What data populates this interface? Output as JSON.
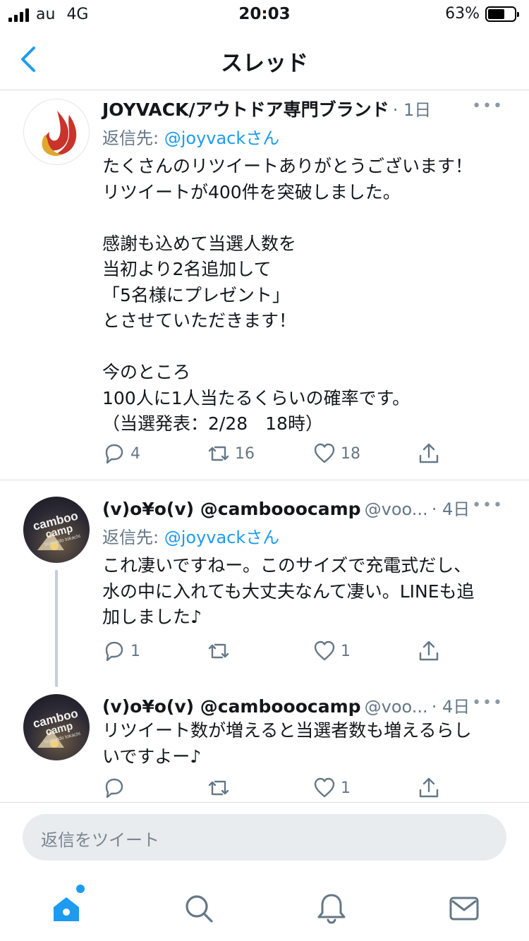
{
  "status_bar": {
    "carrier": "au",
    "network": "4G",
    "time": "20:03",
    "battery": "63%",
    "battery_level": 0.63
  },
  "nav": {
    "title": "スレッド"
  },
  "tweets": [
    {
      "name": "JOYVACK/アウトドア専門ブランド",
      "handle": "",
      "time": "· 1日",
      "reply_label": "返信先: ",
      "reply_mention": "@joyvackさん",
      "text": "たくさんのリツイートありがとうございます！\nリツイートが400件を突破しました。\n\n感謝も込めて当選人数を\n当初より2名追加して\n「5名様にプレゼント」\nとさせていただきます！\n\n今のところ\n100人に1人当たるくらいの確率です。\n（当選発表：2/28　18時）",
      "reply_count": "4",
      "retweet_count": "16",
      "like_count": "18"
    },
    {
      "name": "(v)o¥o(v) @cambooocamp",
      "handle": "@voo...",
      "time": "· 4日",
      "reply_label": "返信先: ",
      "reply_mention": "@joyvackさん",
      "text": "これ凄いですねー。このサイズで充電式だし、\n水の中に入れても大丈夫なんて凄い。LINEも追\n加しました♪",
      "reply_count": "1",
      "retweet_count": "",
      "like_count": "1"
    },
    {
      "name": "(v)o¥o(v) @cambooocamp",
      "handle": "@voo...",
      "time": "· 4日",
      "text": "リツイート数が増えると当選者数も増えるらし\nいですよー♪",
      "reply_count": "",
      "retweet_count": "",
      "like_count": "1"
    }
  ],
  "avatar_camp_text": {
    "line1": "camboo",
    "line2": "camp",
    "line3": "hokkaido tokachi"
  },
  "reply_box": {
    "placeholder": "返信をツイート"
  },
  "tab_bar": {
    "items": [
      "home-icon",
      "search-icon",
      "notifications-icon",
      "messages-icon"
    ]
  },
  "colors": {
    "accent": "#1d9bf0",
    "secondary_text": "#657786",
    "divider": "#d8dde2"
  }
}
